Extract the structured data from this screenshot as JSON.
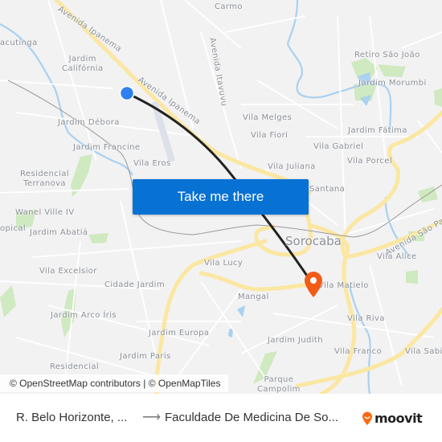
{
  "map": {
    "route": {
      "origin_color": "#2f7ff0",
      "destination_color": "#f25b17",
      "line_color": "#222222"
    },
    "places": [
      {
        "id": "carmo",
        "label": "Carmo"
      },
      {
        "id": "acutinga",
        "label": "acutinga"
      },
      {
        "id": "jardim-california",
        "label": "Jardim\nCalifórnia"
      },
      {
        "id": "jardim-debora",
        "label": "Jardim Débora"
      },
      {
        "id": "jardim-francine",
        "label": "Jardim Francine"
      },
      {
        "id": "vila-eros",
        "label": "Vila Eros"
      },
      {
        "id": "residencial-terranova",
        "label": "Residencial\nTerranova"
      },
      {
        "id": "wanel-ville-iv",
        "label": "Wanel Ville IV"
      },
      {
        "id": "tropical",
        "label": "opical"
      },
      {
        "id": "jardim-abatia",
        "label": "Jardim Abatiá"
      },
      {
        "id": "vila-excelsior",
        "label": "Vila Excelsior"
      },
      {
        "id": "cidade-jardim",
        "label": "Cidade Jardim"
      },
      {
        "id": "jardim-arco-iris",
        "label": "Jardim Arco Íris"
      },
      {
        "id": "jardim-europa",
        "label": "Jardim Europa"
      },
      {
        "id": "jardim-paris",
        "label": "Jardim Paris"
      },
      {
        "id": "residencial",
        "label": "Residencial"
      },
      {
        "id": "retiro-sao-joao",
        "label": "Retiro São João"
      },
      {
        "id": "jardim-morumbi",
        "label": "Jardim Morumbi"
      },
      {
        "id": "vila-melges",
        "label": "Vila Melges"
      },
      {
        "id": "vila-fiori",
        "label": "Vila Fiori"
      },
      {
        "id": "jardim-fatima",
        "label": "Jardim Fátima"
      },
      {
        "id": "vila-gabriel",
        "label": "Vila Gabriel"
      },
      {
        "id": "vila-porcel",
        "label": "Vila Porcel"
      },
      {
        "id": "vila-juliana",
        "label": "Vila Juliana"
      },
      {
        "id": "santana",
        "label": "Santana"
      },
      {
        "id": "sorocaba",
        "label": "Sorocaba"
      },
      {
        "id": "vila-alice",
        "label": "Vila Alice"
      },
      {
        "id": "vila-lucy",
        "label": "Vila Lucy"
      },
      {
        "id": "mangal",
        "label": "Mangal"
      },
      {
        "id": "vila-matielo",
        "label": "Vila Matielo"
      },
      {
        "id": "vila-riva",
        "label": "Vila Riva"
      },
      {
        "id": "jardim-judith",
        "label": "Jardim Judith"
      },
      {
        "id": "vila-franco",
        "label": "Vila Franco"
      },
      {
        "id": "vila-sabia",
        "label": "Vila Sabi"
      },
      {
        "id": "parque-campolim",
        "label": "Parque\nCampolim"
      }
    ],
    "streets": [
      {
        "id": "avenida-ipanema-1",
        "label": "Avenida Ipanema"
      },
      {
        "id": "avenida-ipanema-2",
        "label": "Avenida Ipanema"
      },
      {
        "id": "avenida-itavuvu",
        "label": "Avenida Itavuvu"
      },
      {
        "id": "avenida-sao-paulo",
        "label": "Avenida São Paulo"
      }
    ],
    "cta_label": "Take me there",
    "attribution": "© OpenStreetMap contributors | © OpenMapTiles"
  },
  "footer": {
    "origin": "R. Belo Horizonte, ...",
    "arrow": "⟶",
    "destination": "Faculdade De Medicina De So...",
    "brand": "moovit",
    "brand_color": "#f96b12"
  }
}
